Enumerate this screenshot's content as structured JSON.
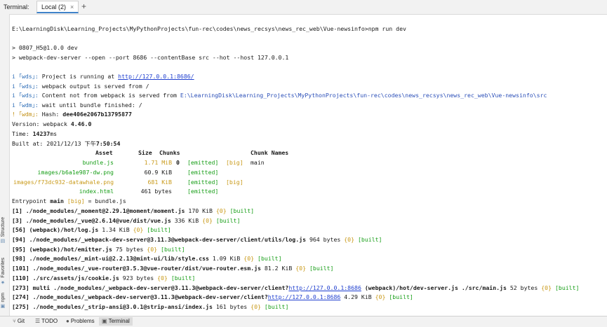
{
  "tabs": {
    "label": "Terminal:",
    "active_tab": "Local (2)",
    "close": "×",
    "add": "+"
  },
  "sidebar": {
    "structure": "Structure",
    "favorites": "Favorites",
    "npm": "npm"
  },
  "terminal": {
    "command_line": "E:\\LearningDisk\\Learning_Projects\\MyPythonProjects\\fun-rec\\codes\\news_recsys\\news_rec_web\\Vue-newsinfo>npm run dev",
    "npm_name": "> 0807_H5@1.0.0 dev",
    "npm_cmd": "> webpack-dev-server --open --port 8686 --contentBase src --hot --host 127.0.0.1",
    "wds_prefix": "i ｢wds｣:",
    "wdm_prefix": "i ｢wdm｣:",
    "wdm_warn_prefix": "! ｢wdm｣:",
    "project_running": "Project is running at",
    "project_url": "http://127.0.0.1:8686/",
    "output_served": "webpack output is served from /",
    "content_not": "Content not from webpack is served from",
    "content_path": "E:\\LearningDisk\\Learning_Projects\\MyPythonProjects\\fun-rec\\codes\\news_recsys\\news_rec_web\\Vue-newsinfo\\src",
    "wait_bundle": "wait until bundle finished: /",
    "hash_label": "Hash:",
    "hash_value": "dee406e2067b13795877",
    "version_label": "Version: webpack",
    "version_value": "4.46.0",
    "time_label": "Time:",
    "time_value": "14237",
    "time_unit": "ms",
    "built_label": "Built at: 2021/12/13 ",
    "built_ampm": "下午",
    "built_time": "7:50:54",
    "col_asset": "Asset",
    "col_size": "Size",
    "col_chunks": "Chunks",
    "col_chunk_names": "Chunk Names",
    "assets": [
      {
        "name": "bundle.js",
        "size": "1.71 MiB",
        "chunk": "0",
        "status": "[emitted]",
        "flag": "[big]",
        "chunk_name": "main"
      },
      {
        "name": "images/b6a1e987-dw.png",
        "size": "60.9 KiB",
        "chunk": "",
        "status": "[emitted]",
        "flag": "",
        "chunk_name": ""
      },
      {
        "name": "images/f73dc932-datawhale.png",
        "size": "681 KiB",
        "chunk": "",
        "status": "[emitted]",
        "flag": "[big]",
        "chunk_name": ""
      },
      {
        "name": "index.html",
        "size": "461 bytes",
        "chunk": "",
        "status": "[emitted]",
        "flag": "",
        "chunk_name": ""
      }
    ],
    "entrypoint_label": "Entrypoint",
    "entrypoint_name": "main",
    "entrypoint_flag": "[big]",
    "entrypoint_eq": "= bundle.js",
    "modules": [
      {
        "id": "[1]",
        "path": "./node_modules/_moment@2.29.1@moment/moment.js",
        "url": "",
        "rest": "",
        "size": "170 KiB",
        "chunk": "{0}",
        "built": "[built]"
      },
      {
        "id": "[3]",
        "path": "./node_modules/_vue@2.6.14@vue/dist/vue.js",
        "url": "",
        "rest": "",
        "size": "336 KiB",
        "chunk": "{0}",
        "built": "[built]"
      },
      {
        "id": "[56]",
        "path": "(webpack)/hot/log.js",
        "url": "",
        "rest": "",
        "size": "1.34 KiB",
        "chunk": "{0}",
        "built": "[built]"
      },
      {
        "id": "[94]",
        "path": "./node_modules/_webpack-dev-server@3.11.3@webpack-dev-server/client/utils/log.js",
        "url": "",
        "rest": "",
        "size": "964 bytes",
        "chunk": "{0}",
        "built": "[built]"
      },
      {
        "id": "[95]",
        "path": "(webpack)/hot/emitter.js",
        "url": "",
        "rest": "",
        "size": "75 bytes",
        "chunk": "{0}",
        "built": "[built]"
      },
      {
        "id": "[98]",
        "path": "./node_modules/_mint-ui@2.2.13@mint-ui/lib/style.css",
        "url": "",
        "rest": "",
        "size": "1.09 KiB",
        "chunk": "{0}",
        "built": "[built]"
      },
      {
        "id": "[101]",
        "path": "./node_modules/_vue-router@3.5.3@vue-router/dist/vue-router.esm.js",
        "url": "",
        "rest": "",
        "size": "81.2 KiB",
        "chunk": "{0}",
        "built": "[built]"
      },
      {
        "id": "[110]",
        "path": "./src/assets/js/cookie.js",
        "url": "",
        "rest": "",
        "size": "923 bytes",
        "chunk": "{0}",
        "built": "[built]"
      },
      {
        "id": "[273]",
        "path": "multi ./node_modules/_webpack-dev-server@3.11.3@webpack-dev-server/client?",
        "url": "http://127.0.0.1:8686",
        "rest": " (webpack)/hot/dev-server.js ./src/main.js",
        "size": "52 bytes",
        "chunk": "{0}",
        "built": "[built]"
      },
      {
        "id": "[274]",
        "path": "./node_modules/_webpack-dev-server@3.11.3@webpack-dev-server/client?",
        "url": "http://127.0.0.1:8686",
        "rest": "",
        "size": "4.29 KiB",
        "chunk": "{0}",
        "built": "[built]"
      },
      {
        "id": "[275]",
        "path": "./node_modules/_strip-ansi@3.0.1@strip-ansi/index.js",
        "url": "",
        "rest": "",
        "size": "161 bytes",
        "chunk": "{0}",
        "built": "[built]"
      }
    ]
  },
  "bottom": {
    "git": "Git",
    "todo": "TODO",
    "problems": "Problems",
    "terminal": "Terminal"
  }
}
